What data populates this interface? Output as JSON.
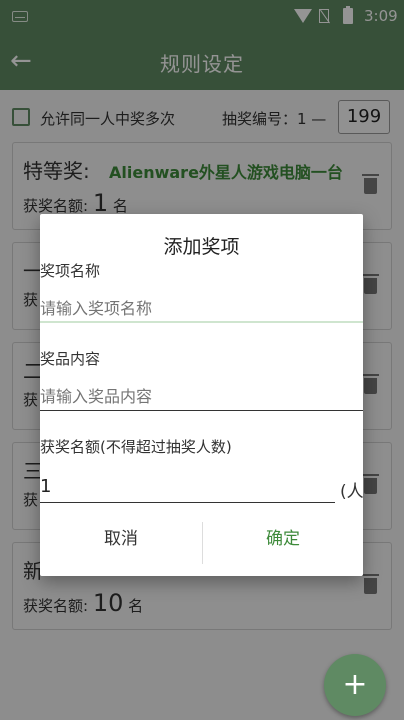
{
  "status": {
    "time": "3:09"
  },
  "appbar": {
    "title": "规则设定",
    "back_icon": "arrow-left-icon"
  },
  "options": {
    "allow_multi_label": "允许同一人中奖多次",
    "number_label": "抽奖编号：1 —",
    "number_max": "199"
  },
  "prizes": [
    {
      "name": "特等奖:",
      "content": "Alienware外星人游戏电脑一台",
      "count_label": "获奖名额:",
      "count": "1",
      "unit": "名"
    },
    {
      "name": "一",
      "content": "",
      "count_label": "获",
      "count": "",
      "unit": ""
    },
    {
      "name": "二",
      "content": "",
      "count_label": "获",
      "count": "",
      "unit": ""
    },
    {
      "name": "三",
      "content": "",
      "count_label": "获",
      "count": "",
      "unit": ""
    },
    {
      "name": "新",
      "content": "",
      "count_label": "获奖名额:",
      "count": "10",
      "unit": "名"
    }
  ],
  "dialog": {
    "title": "添加奖项",
    "name_label": "奖项名称",
    "name_placeholder": "请输入奖项名称",
    "content_label": "奖品内容",
    "content_placeholder": "请输入奖品内容",
    "qty_label": "获奖名额(不得超过抽奖人数)",
    "qty_value": "1",
    "qty_unit": "(人",
    "cancel": "取消",
    "confirm": "确定"
  },
  "fab": {
    "label": "+"
  },
  "colors": {
    "primary": "#5f8a63",
    "accent_green": "#3d8a3a"
  }
}
